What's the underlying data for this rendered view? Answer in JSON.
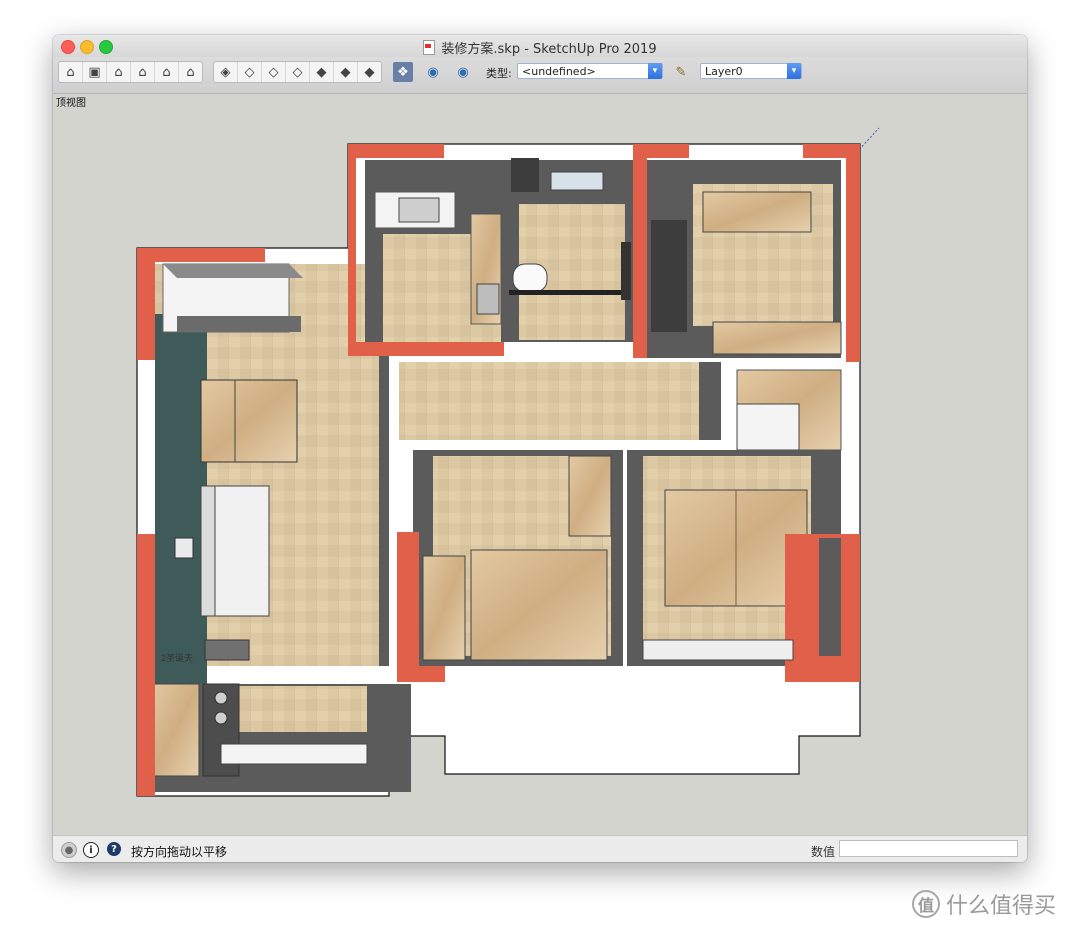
{
  "window": {
    "title": "装修方案.skp - SketchUp Pro 2019"
  },
  "toolbar": {
    "views_group": [
      "iso-view-icon",
      "top-view-icon",
      "front-view-icon",
      "right-view-icon",
      "back-view-icon",
      "left-view-icon"
    ],
    "styles_group": [
      "xray-icon",
      "wireframe-icon",
      "hidden-line-icon",
      "shaded-icon",
      "shaded-textures-icon",
      "monochrome-icon",
      "back-edges-icon"
    ],
    "component_type_label": "类型:",
    "component_type_value": "<undefined>",
    "layer_value": "Layer0"
  },
  "viewport": {
    "view_name": "顶视图",
    "room_label": "2圣诞夫"
  },
  "statusbar": {
    "hint": "按方向拖动以平移",
    "measurements_label": "数值",
    "measurements_value": ""
  },
  "watermark": {
    "badge": "值",
    "text": "什么值得买"
  },
  "colors": {
    "accent_wall": "#e0604a",
    "floor_tile": "#d9c7a2",
    "wall_dark": "#5a5a5a",
    "feature_wall": "#3e5a58",
    "wood": "#d7b98f"
  }
}
